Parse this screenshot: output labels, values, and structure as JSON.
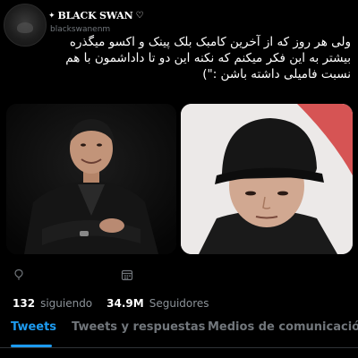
{
  "tweet": {
    "display_name": "BLACK SWAN",
    "name_suffix_icon": "heart-outline-icon",
    "handle": "blackswanenm",
    "text_lines": [
      "ولی هر روز که از آخرین کامبک بلک پینک و اکسو میگذره",
      "بیشتر به این فکر میکنم که نکنه این دو تا داداشمون با هم",
      "نسبت  فامیلی داشته باشن :\")"
    ],
    "photos": [
      {
        "alt": "man in dark suit against dark background",
        "icon": "photo-icon"
      },
      {
        "alt": "man wearing black cap",
        "icon": "photo-icon"
      }
    ]
  },
  "profile": {
    "icons": [
      "balloon-icon",
      "calendar-icon"
    ],
    "following_count": "132",
    "following_label": "siguiendo",
    "followers_count": "34.9M",
    "followers_label": "Seguidores"
  },
  "tabs": [
    {
      "label": "Tweets",
      "active": true
    },
    {
      "label": "Tweets y respuestas",
      "active": false
    },
    {
      "label": "Medios de comunicación",
      "active": false
    }
  ],
  "colors": {
    "background": "#000000",
    "accent": "#1d9bf0",
    "text_primary": "#e7e9ea",
    "text_secondary": "#71767b"
  }
}
